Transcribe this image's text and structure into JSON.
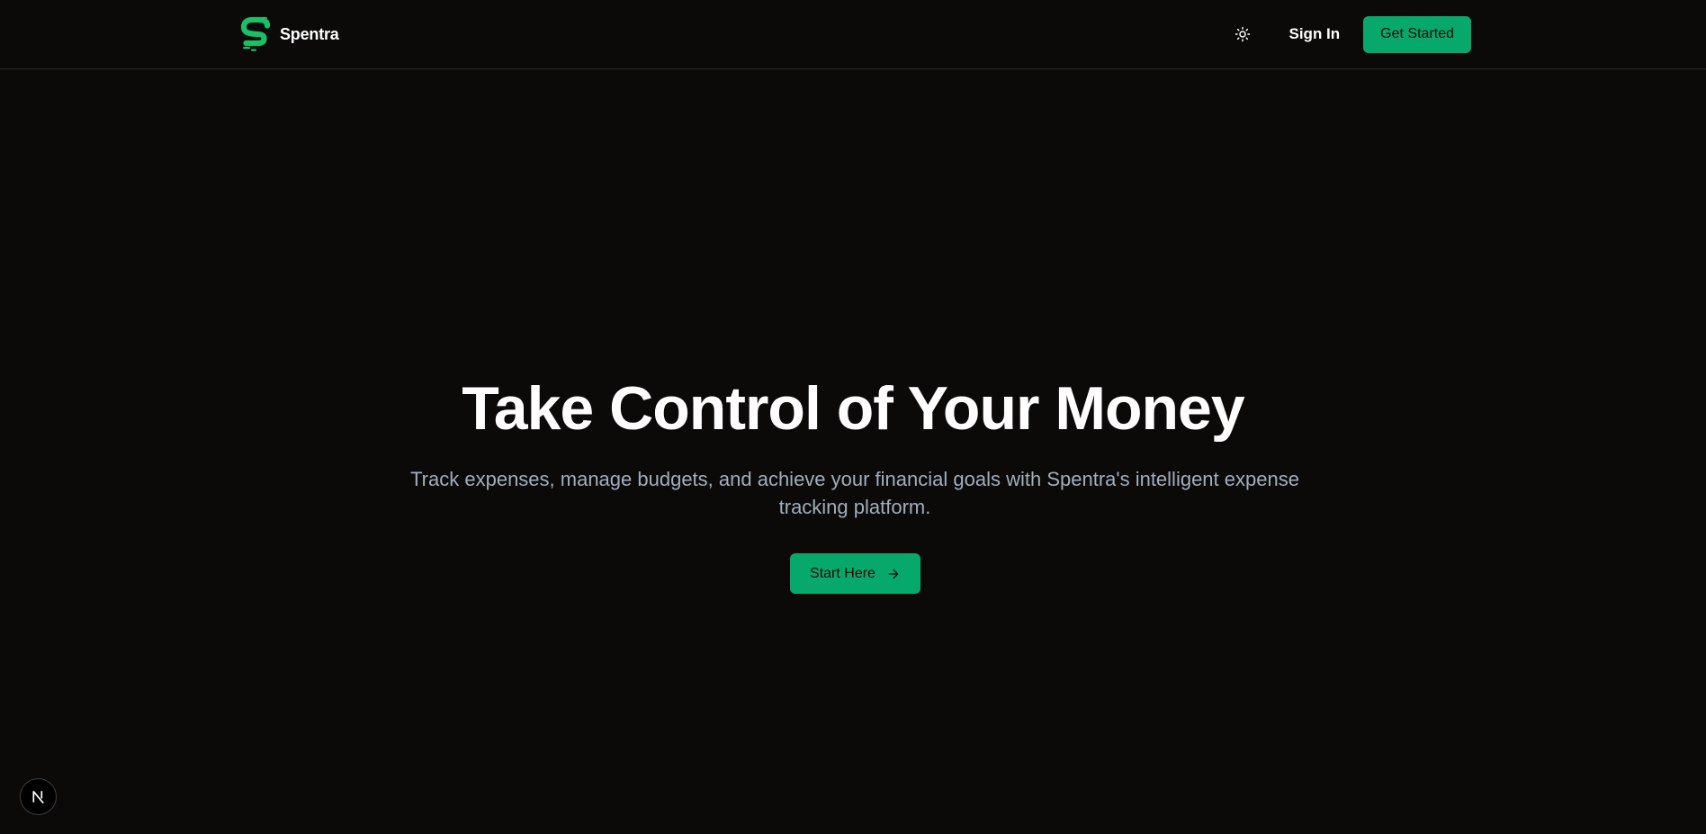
{
  "header": {
    "brand_name": "Spentra",
    "sign_in_label": "Sign In",
    "get_started_label": "Get Started",
    "theme_toggle_icon": "sun-icon"
  },
  "hero": {
    "title": "Take Control of Your Money",
    "subtitle": "Track expenses, manage budgets, and achieve your financial goals with Spentra's intelligent expense tracking platform.",
    "cta_label": "Start Here",
    "cta_icon": "arrow-right-icon"
  },
  "badge": {
    "letter": "N",
    "icon": "nextjs-icon"
  },
  "colors": {
    "background": "#0b0a09",
    "accent": "#06a96b",
    "brand_green": "#18c068",
    "subtitle_text": "#a2adbd",
    "border": "#2a2a28"
  }
}
